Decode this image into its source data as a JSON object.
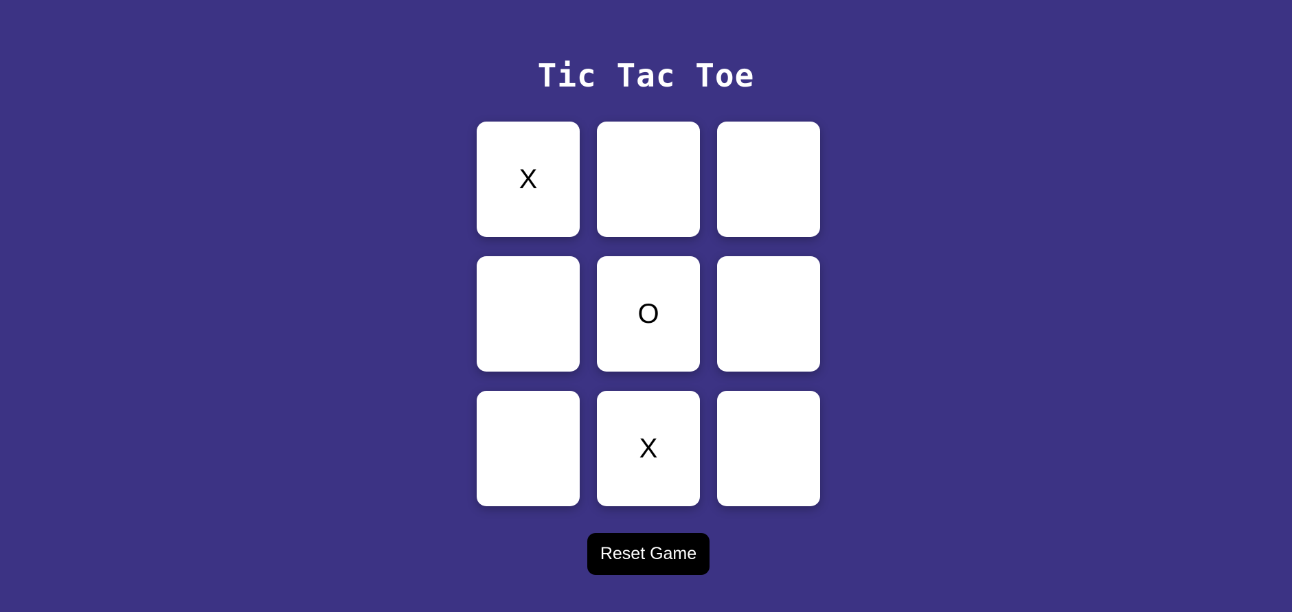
{
  "header": {
    "title": "Tic Tac Toe"
  },
  "board": {
    "cells": [
      "X",
      "",
      "",
      "",
      "O",
      "",
      "",
      "X",
      ""
    ]
  },
  "controls": {
    "reset_label": "Reset Game"
  },
  "colors": {
    "background": "#3c3384",
    "cell": "#ffffff",
    "mark": "#000000",
    "button": "#000000",
    "button_text": "#ffffff",
    "title": "#ffffff"
  }
}
